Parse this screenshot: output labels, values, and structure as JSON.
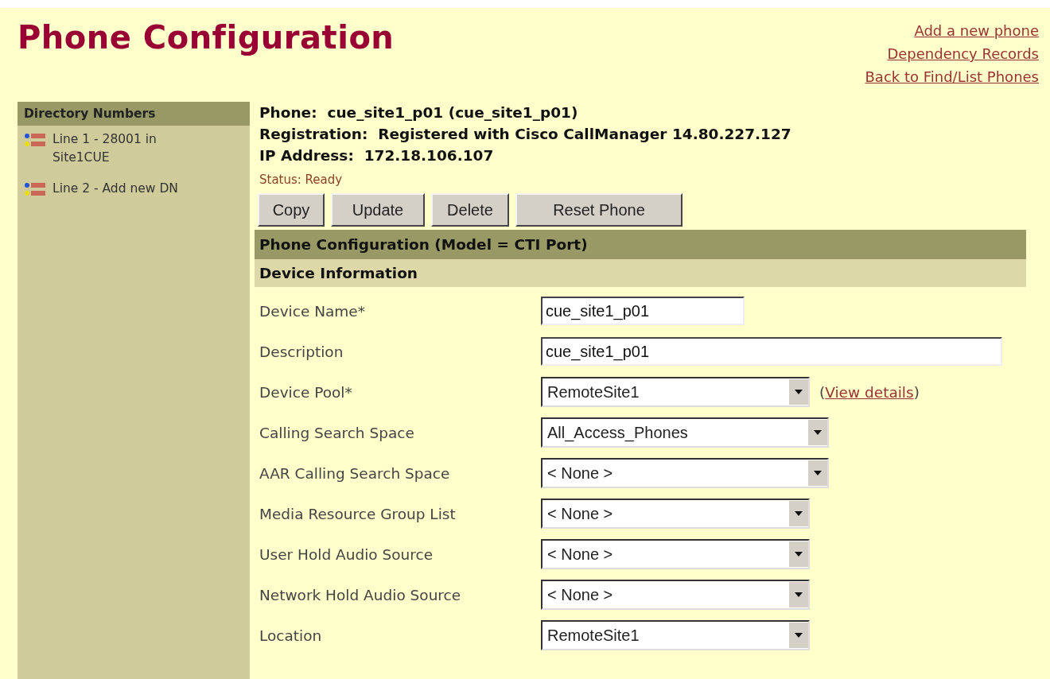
{
  "title": "Phone Configuration",
  "links": [
    "Add a new phone",
    "Dependency Records",
    "Back to Find/List Phones"
  ],
  "sidebar": {
    "heading": "Directory Numbers",
    "items": [
      {
        "label": "Line 1 - 28001 in Site1CUE"
      },
      {
        "label": "Line 2 - Add new DN"
      }
    ]
  },
  "summary": [
    {
      "label": "Phone:",
      "value": "cue_site1_p01 (cue_site1_p01)"
    },
    {
      "label": "Registration:",
      "value": "Registered with Cisco CallManager 14.80.227.127"
    },
    {
      "label": "IP Address:",
      "value": "172.18.106.107"
    }
  ],
  "status": "Status: Ready",
  "buttons": [
    "Copy",
    "Update",
    "Delete",
    "Reset Phone"
  ],
  "section_title": "Phone Configuration (Model = CTI Port)",
  "subsection_title": "Device Information",
  "fields": [
    {
      "label": "Device Name*",
      "kind": "short-text",
      "value": "cue_site1_p01"
    },
    {
      "label": "Description",
      "kind": "long-text",
      "value": "cue_site1_p01"
    },
    {
      "label": "Device Pool*",
      "kind": "select",
      "value": "RemoteSite1",
      "link": {
        "open": "(",
        "text": "View details",
        "close": ")"
      }
    },
    {
      "label": "Calling Search Space",
      "kind": "wide-select",
      "value": "All_Access_Phones"
    },
    {
      "label": "AAR Calling Search Space",
      "kind": "wide-select",
      "value": "< None >"
    },
    {
      "label": "Media Resource Group List",
      "kind": "select",
      "value": "< None >"
    },
    {
      "label": "User Hold Audio Source",
      "kind": "select",
      "value": "< None >"
    },
    {
      "label": "Network Hold Audio Source",
      "kind": "select",
      "value": "< None >"
    },
    {
      "label": "Location",
      "kind": "select",
      "value": "RemoteSite1"
    }
  ]
}
